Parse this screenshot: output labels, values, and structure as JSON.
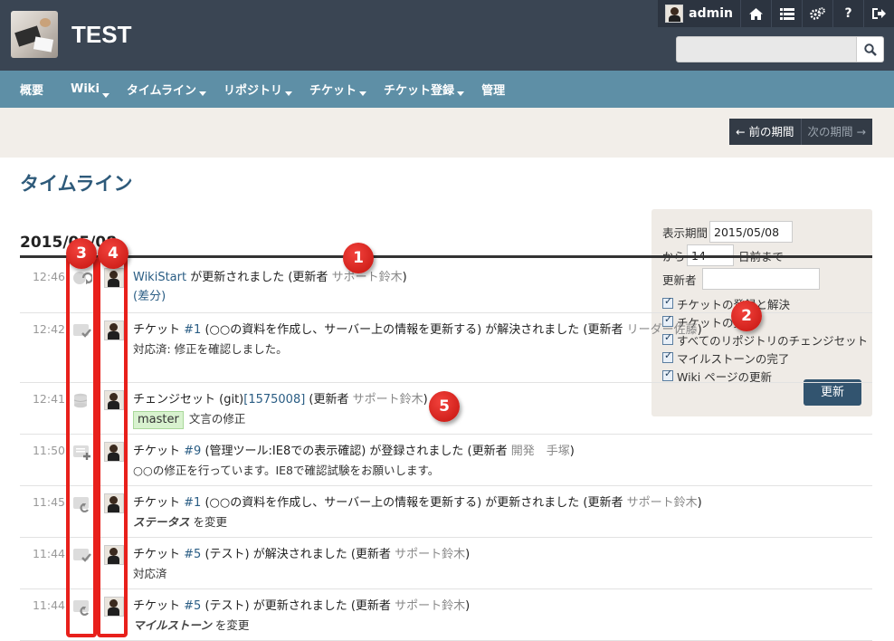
{
  "header": {
    "site_title": "TEST",
    "user_name": "admin",
    "search_placeholder": "",
    "icons": [
      "home-icon",
      "list-icon",
      "gears-icon",
      "help-icon",
      "logout-icon",
      "search-icon"
    ]
  },
  "nav": {
    "items": [
      {
        "label": "概要",
        "dropdown": false
      },
      {
        "label": "Wiki",
        "dropdown": true
      },
      {
        "label": "タイムライン",
        "dropdown": true,
        "active": true
      },
      {
        "label": "リポジトリ",
        "dropdown": true
      },
      {
        "label": "チケット",
        "dropdown": true
      },
      {
        "label": "チケット登録",
        "dropdown": true
      },
      {
        "label": "管理",
        "dropdown": false
      }
    ]
  },
  "period": {
    "prev_label": "← 前の期間",
    "next_label": "次の期間 →"
  },
  "page": {
    "title": "タイムライン"
  },
  "filter": {
    "period_label": "表示期間",
    "period_value": "2015/05/08",
    "from_label": "から",
    "days_value": "14",
    "days_suffix": "日前まで",
    "author_label": "更新者",
    "author_value": "",
    "checkboxes": [
      {
        "label": "チケットの登録と解決",
        "checked": true
      },
      {
        "label": "チケットの更新",
        "checked": true
      },
      {
        "label": "すべてのリポジトリのチェンジセット",
        "checked": true
      },
      {
        "label": "マイルストーンの完了",
        "checked": true
      },
      {
        "label": "Wiki ページの更新",
        "checked": true
      }
    ],
    "submit_label": "更新"
  },
  "timeline": {
    "date": "2015/05/08",
    "events": [
      {
        "time": "12:46",
        "icon": "wiki-edit-icon",
        "line": [
          "",
          "WikiStart",
          " が更新されました (更新者 ",
          "サポート鈴木",
          ")"
        ],
        "desc": "(差分)",
        "desc_link": true
      },
      {
        "time": "12:42",
        "icon": "ticket-resolved-icon",
        "line": [
          "チケット ",
          "#1",
          " (○○の資料を作成し、サーバー上の情報を更新する) が解決されました (更新者 ",
          "リーダー佐藤",
          ")"
        ],
        "desc": "対応済: 修正を確認しました。"
      },
      {
        "time": "12:41",
        "icon": "changeset-icon",
        "line": [
          "チェンジセット (git)",
          "[1575008]",
          " (更新者 ",
          "サポート鈴木",
          ")"
        ],
        "branch": "master",
        "desc": "文言の修正"
      },
      {
        "time": "11:50",
        "icon": "ticket-new-icon",
        "line": [
          "チケット ",
          "#9",
          " (管理ツール:IE8での表示確認) が登録されました (更新者 ",
          "開発　手塚",
          ")"
        ],
        "desc": "○○の修正を行っています。IE8で確認試験をお願いします。"
      },
      {
        "time": "11:45",
        "icon": "ticket-edit-icon",
        "line": [
          "チケット ",
          "#1",
          " (○○の資料を作成し、サーバー上の情報を更新する) が更新されました (更新者 ",
          "サポート鈴木",
          ")"
        ],
        "desc_em": "ステータス",
        "desc": " を変更"
      },
      {
        "time": "11:44",
        "icon": "ticket-resolved-icon",
        "line": [
          "チケット ",
          "#5",
          " (テスト) が解決されました (更新者 ",
          "サポート鈴木",
          ")"
        ],
        "desc": "対応済"
      },
      {
        "time": "11:44",
        "icon": "ticket-edit-icon",
        "line": [
          "チケット ",
          "#5",
          " (テスト) が更新されました (更新者 ",
          "サポート鈴木",
          ")"
        ],
        "desc_em": "マイルストーン",
        "desc": " を変更"
      }
    ]
  },
  "annotations": [
    "1",
    "2",
    "3",
    "4",
    "5"
  ],
  "colors": {
    "header_bg": "#3a4553",
    "nav_bg": "#5e8fa6",
    "annotation_red": "#e8201b",
    "link": "#2a5d84"
  }
}
